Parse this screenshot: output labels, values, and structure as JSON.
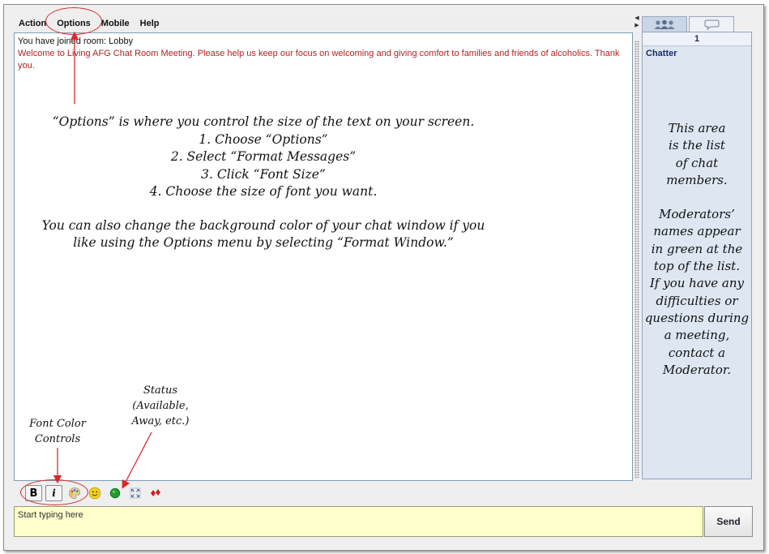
{
  "menu": [
    "Action",
    "Options",
    "Mobile",
    "Help"
  ],
  "chat": {
    "system_message": "You have joined room: Lobby",
    "welcome_message": "Welcome to Living AFG Chat Room Meeting. Please help us keep our focus on welcoming and giving comfort to families and friends of alcoholics. Thank you."
  },
  "users_panel": {
    "tabs": [
      {
        "icon": "users-icon"
      },
      {
        "icon": "chat-bubble-icon"
      }
    ],
    "count": "1",
    "room_label": "Chatter"
  },
  "annotations": {
    "options_lines": [
      "“Options” is where you control the size of the text on your screen.",
      "1.  Choose  “Options”",
      "2.  Select  “Format Messages”",
      "3.  Click  “Font Size”",
      "4.  Choose the size of font you want."
    ],
    "background_lines": [
      "You can also change the background color of your chat window if you",
      "like using the Options menu by selecting  “Format Window.”"
    ],
    "members_lines": [
      "This area",
      "is the list",
      "of chat",
      "members."
    ],
    "moderator_lines": [
      "Moderators’",
      "names appear",
      "in green at the",
      "top of the list.",
      "If you have any",
      "difficulties or",
      "questions during",
      "a meeting,",
      "contact a",
      "Moderator."
    ],
    "status_lines": [
      "Status",
      "(Available,",
      "Away, etc.)"
    ],
    "font_color_lines": [
      "Font Color",
      "Controls"
    ]
  },
  "toolbar": {
    "bold_label": "B",
    "italic_label": "i",
    "icons": [
      "bold-icon",
      "italic-icon",
      "color-palette-icon",
      "smiley-icon",
      "status-icon",
      "expand-icon",
      "card-icon"
    ]
  },
  "input": {
    "placeholder": "Start typing here"
  },
  "send_label": "Send",
  "colors": {
    "welcome_text": "#b22222",
    "input_background": "#ffffcc",
    "annotation_red": "#d62a2a",
    "status_green": "#1f9b2f"
  }
}
